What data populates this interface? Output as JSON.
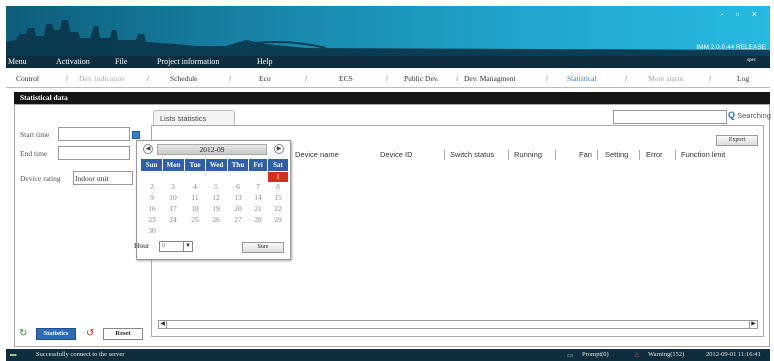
{
  "window": {
    "controls": "- ▫ ×",
    "release": "IMM 2.0.0.44 RELEASE"
  },
  "menu": {
    "items": [
      "Menu",
      "Activation",
      "File",
      "Project information",
      "Help"
    ],
    "user": "spec"
  },
  "nav": {
    "tabs": [
      "Control",
      "Dev. indication",
      "Schedule",
      "Eco",
      "ECS",
      "Public Dev.",
      "Dev. Managment",
      "Statistical",
      "More alarm",
      "Log"
    ],
    "active": "Statistical"
  },
  "panel": {
    "title": "Statistical data"
  },
  "form": {
    "start_time_label": "Start time",
    "end_time_label": "End time",
    "device_rating_label": "Device rating",
    "device_rating_value": "Indoor unit"
  },
  "calendar": {
    "month": "2012-09",
    "prev": "◀",
    "next": "▶",
    "dow": [
      "Sun",
      "Mon",
      "Tue",
      "Wed",
      "Thu",
      "Fri",
      "Sat"
    ],
    "weeks": [
      [
        "",
        "",
        "",
        "",
        "",
        "",
        "1"
      ],
      [
        "2",
        "3",
        "4",
        "5",
        "6",
        "7",
        "8"
      ],
      [
        "9",
        "10",
        "11",
        "12",
        "13",
        "14",
        "15"
      ],
      [
        "16",
        "17",
        "18",
        "19",
        "20",
        "21",
        "22"
      ],
      [
        "23",
        "24",
        "25",
        "26",
        "27",
        "28",
        "29"
      ],
      [
        "30",
        "",
        "",
        "",
        "",
        "",
        ""
      ]
    ],
    "selected_day": "1",
    "hour_label": "Hour",
    "hour_value": "0",
    "sure_label": "Sure"
  },
  "list": {
    "tab_label": "Lists statistics",
    "search_label": "Searching",
    "export_label": "Export",
    "columns": [
      "Device name",
      "Device ID",
      "Switch status",
      "Running",
      "Fan",
      "Setting",
      "Error",
      "Function limit"
    ]
  },
  "actions": {
    "statistics_label": "Statistics",
    "reset_label": "Reset"
  },
  "status": {
    "message": "Successfully connect to the server",
    "prompt": "Prompt(0)",
    "warning": "Warning(152)",
    "datetime": "2012-09-01 11:16:41"
  },
  "colors": {
    "accent": "#2f7fc0",
    "header": "#0e2e40",
    "selected_day": "#d92c1a",
    "dow_bg": "#2e5fa8"
  }
}
